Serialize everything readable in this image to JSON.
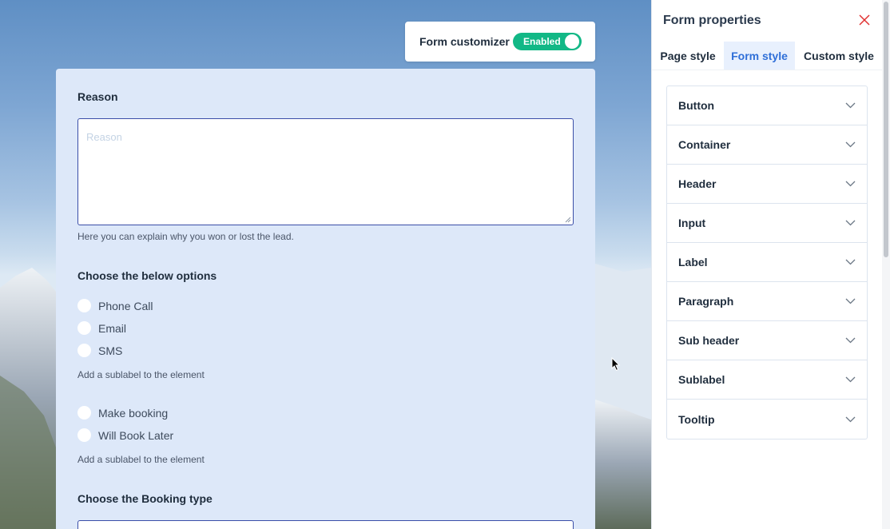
{
  "customizer": {
    "label": "Form customizer",
    "toggle_text": "Enabled"
  },
  "form": {
    "reason": {
      "label": "Reason",
      "placeholder": "Reason",
      "hint": "Here you can explain why you won or lost the lead."
    },
    "options": {
      "label": "Choose the below options",
      "group1": [
        "Phone Call",
        "Email",
        "SMS"
      ],
      "sublabel1": "Add a sublabel to the element",
      "group2": [
        "Make booking",
        "Will Book Later"
      ],
      "sublabel2": "Add a sublabel to the element"
    },
    "booking": {
      "label": "Choose the Booking type"
    }
  },
  "panel": {
    "title": "Form properties",
    "tabs": [
      "Page style",
      "Form style",
      "Custom style"
    ],
    "active_tab": "Form style",
    "sections": [
      "Button",
      "Container",
      "Header",
      "Input",
      "Label",
      "Paragraph",
      "Sub header",
      "Sublabel",
      "Tooltip"
    ]
  },
  "colors": {
    "accent": "#2f6fd8",
    "toggle": "#12b886",
    "close": "#e03131"
  }
}
